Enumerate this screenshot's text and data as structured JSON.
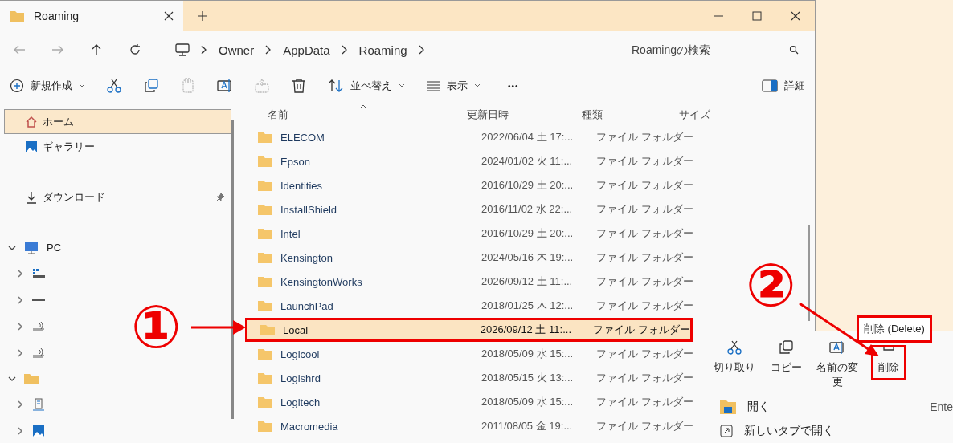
{
  "window": {
    "tab_title": "Roaming"
  },
  "nav": {
    "buttons": [
      {
        "kind": "back",
        "disabled": true
      },
      {
        "kind": "forward",
        "disabled": true
      },
      {
        "kind": "up",
        "disabled": false
      },
      {
        "kind": "refresh",
        "disabled": false
      }
    ],
    "breadcrumb": [
      "Owner",
      "AppData",
      "Roaming"
    ],
    "search": {
      "placeholder": "Roamingの検索"
    }
  },
  "toolbar": {
    "buttons": [
      {
        "kind": "new",
        "label": "新規作成",
        "dropdown": true,
        "disabled": false
      },
      {
        "kind": "cut",
        "disabled": false
      },
      {
        "kind": "copy",
        "disabled": false
      },
      {
        "kind": "paste",
        "disabled": true
      },
      {
        "kind": "rename",
        "disabled": false
      },
      {
        "kind": "share",
        "disabled": true
      },
      {
        "kind": "delete",
        "disabled": false
      },
      {
        "kind": "sort",
        "label": "並べ替え",
        "dropdown": true,
        "disabled": false
      },
      {
        "kind": "view",
        "label": "表示",
        "dropdown": true,
        "disabled": false
      },
      {
        "kind": "more",
        "label": "•••",
        "disabled": false
      }
    ],
    "details": {
      "label": "詳細"
    }
  },
  "sidebar": {
    "groups": [
      [
        {
          "kind": "home",
          "label": "ホーム",
          "selected": true
        },
        {
          "kind": "gallery",
          "label": "ギャラリー",
          "selected": false
        }
      ],
      [
        {
          "kind": "download",
          "label": "ダウンロード",
          "selected": false,
          "pinned": true
        }
      ],
      [
        {
          "kind": "pc",
          "label": "PC",
          "selected": false,
          "expanded": true,
          "children": [
            {
              "kind": "drive-win",
              "expanded": false
            },
            {
              "kind": "drive",
              "expanded": false
            },
            {
              "kind": "network",
              "expanded": false
            },
            {
              "kind": "network",
              "expanded": false
            }
          ]
        },
        {
          "kind": "folder",
          "selected": false,
          "expanded": true,
          "children": [
            {
              "kind": "server",
              "expanded": false
            },
            {
              "kind": "gallery",
              "expanded": false
            }
          ]
        }
      ]
    ]
  },
  "table": {
    "columns": [
      "名前",
      "更新日時",
      "種類",
      "サイズ"
    ],
    "rows": [
      {
        "name": "ELECOM",
        "date": "2022/06/04 土 17:...",
        "type": "ファイル フォルダー",
        "selected": false
      },
      {
        "name": "Epson",
        "date": "2024/01/02 火 11:...",
        "type": "ファイル フォルダー",
        "selected": false
      },
      {
        "name": "Identities",
        "date": "2016/10/29 土 20:...",
        "type": "ファイル フォルダー",
        "selected": false
      },
      {
        "name": "InstallShield",
        "date": "2016/11/02 水 22:...",
        "type": "ファイル フォルダー",
        "selected": false
      },
      {
        "name": "Intel",
        "date": "2016/10/29 土 20:...",
        "type": "ファイル フォルダー",
        "selected": false
      },
      {
        "name": "Kensington",
        "date": "2024/05/16 木 19:...",
        "type": "ファイル フォルダー",
        "selected": false
      },
      {
        "name": "KensingtonWorks",
        "date": "2026/09/12 土 11:...",
        "type": "ファイル フォルダー",
        "selected": false
      },
      {
        "name": "LaunchPad",
        "date": "2018/01/25 木 12:...",
        "type": "ファイル フォルダー",
        "selected": false
      },
      {
        "name": "Local",
        "date": "2026/09/12 土 11:...",
        "type": "ファイル フォルダー",
        "selected": true
      },
      {
        "name": "Logicool",
        "date": "2018/05/09 水 15:...",
        "type": "ファイル フォルダー",
        "selected": false
      },
      {
        "name": "Logishrd",
        "date": "2018/05/15 火 13:...",
        "type": "ファイル フォルダー",
        "selected": false
      },
      {
        "name": "Logitech",
        "date": "2018/05/09 水 15:...",
        "type": "ファイル フォルダー",
        "selected": false
      },
      {
        "name": "Macromedia",
        "date": "2011/08/05 金 19:...",
        "type": "ファイル フォルダー",
        "selected": false
      }
    ]
  },
  "context_menu": {
    "actions": [
      {
        "kind": "cut",
        "label": "切り取り",
        "selected": false
      },
      {
        "kind": "copy",
        "label": "コピー",
        "selected": false
      },
      {
        "kind": "rename",
        "label": "名前の変更",
        "selected": false
      },
      {
        "kind": "delete",
        "label": "削除",
        "selected": true
      }
    ],
    "items": [
      {
        "kind": "open",
        "label": "開く",
        "shortcut": "Ente"
      },
      {
        "kind": "new-tab",
        "label": "新しいタブで開く"
      }
    ],
    "tooltip": "削除 (Delete)"
  },
  "annotations": [
    {
      "text": "①"
    },
    {
      "text": "②"
    }
  ]
}
